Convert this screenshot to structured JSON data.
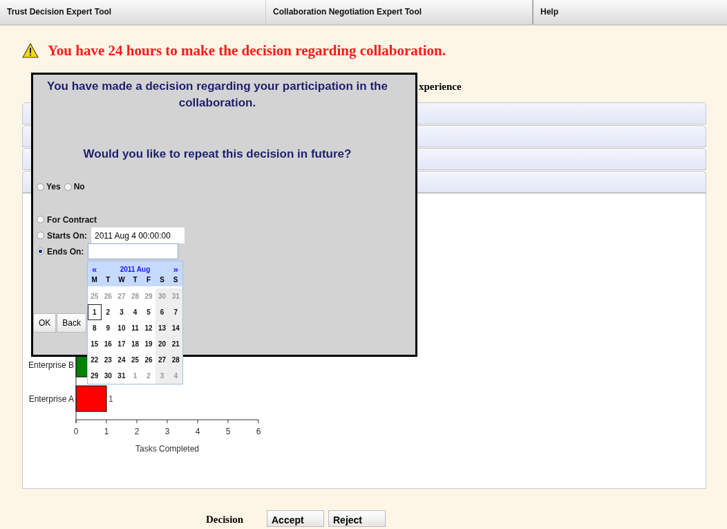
{
  "menu": [
    {
      "label": "Trust Decision Expert Tool"
    },
    {
      "label": "Collaboration Negotiation Expert Tool"
    },
    {
      "label": "Help"
    }
  ],
  "warning": "You have 24 hours to make the decision regarding collaboration.",
  "heading": "xperience",
  "sections": [
    {
      "expanded": false
    },
    {
      "expanded": false
    },
    {
      "expanded": false
    },
    {
      "expanded": true
    }
  ],
  "panel": {
    "covered_bar": {
      "color": "#008000"
    },
    "chart_data": {
      "type": "bar",
      "orientation": "horizontal",
      "categories": [
        "Enterprise B",
        "Enterprise A"
      ],
      "xlabel": "Tasks Completed",
      "xlim": [
        0,
        6
      ],
      "xticks": [
        0,
        1,
        2,
        3,
        4,
        5,
        6
      ],
      "data_labels": true,
      "series": [
        {
          "color": "#ff0000",
          "values": [
            null,
            1
          ]
        }
      ]
    }
  },
  "decision": {
    "label": "Decision",
    "buttons": [
      "Accept",
      "Reject"
    ]
  },
  "dialog": {
    "message": "You have made a decision regarding your participation in the collaboration.",
    "question": "Would you like to repeat this decision in future?",
    "choice": [
      {
        "label": "Yes",
        "selected": false
      },
      {
        "label": "No",
        "selected": false
      }
    ],
    "period": [
      {
        "kind": "plain",
        "label": "For Contract",
        "selected": false
      },
      {
        "kind": "date",
        "label": "Starts On:",
        "value": "2011 Aug 4 00:00:00",
        "selected": false
      },
      {
        "kind": "date",
        "label": "Ends On:",
        "selected": true
      }
    ],
    "buttons": [
      "OK",
      "Back"
    ],
    "calendar": {
      "prev": "«",
      "title": "2011 Aug",
      "next": "»",
      "weekdays": [
        "M",
        "T",
        "W",
        "T",
        "F",
        "S",
        "S"
      ],
      "weeks": [
        [
          {
            "day": "25",
            "outside": true,
            "today": false
          },
          {
            "day": "26",
            "outside": true,
            "today": false
          },
          {
            "day": "27",
            "outside": true,
            "today": false
          },
          {
            "day": "28",
            "outside": true,
            "today": false
          },
          {
            "day": "29",
            "outside": true,
            "today": false
          },
          {
            "day": "30",
            "outside": true,
            "today": false
          },
          {
            "day": "31",
            "outside": true,
            "today": false
          }
        ],
        [
          {
            "day": "1",
            "outside": false,
            "today": true
          },
          {
            "day": "2",
            "outside": false,
            "today": false
          },
          {
            "day": "3",
            "outside": false,
            "today": false
          },
          {
            "day": "4",
            "outside": false,
            "today": false
          },
          {
            "day": "5",
            "outside": false,
            "today": false
          },
          {
            "day": "6",
            "outside": false,
            "today": false
          },
          {
            "day": "7",
            "outside": false,
            "today": false
          }
        ],
        [
          {
            "day": "8",
            "outside": false,
            "today": false
          },
          {
            "day": "9",
            "outside": false,
            "today": false
          },
          {
            "day": "10",
            "outside": false,
            "today": false
          },
          {
            "day": "11",
            "outside": false,
            "today": false
          },
          {
            "day": "12",
            "outside": false,
            "today": false
          },
          {
            "day": "13",
            "outside": false,
            "today": false
          },
          {
            "day": "14",
            "outside": false,
            "today": false
          }
        ],
        [
          {
            "day": "15",
            "outside": false,
            "today": false
          },
          {
            "day": "16",
            "outside": false,
            "today": false
          },
          {
            "day": "17",
            "outside": false,
            "today": false
          },
          {
            "day": "18",
            "outside": false,
            "today": false
          },
          {
            "day": "19",
            "outside": false,
            "today": false
          },
          {
            "day": "20",
            "outside": false,
            "today": false
          },
          {
            "day": "21",
            "outside": false,
            "today": false
          }
        ],
        [
          {
            "day": "22",
            "outside": false,
            "today": false
          },
          {
            "day": "23",
            "outside": false,
            "today": false
          },
          {
            "day": "24",
            "outside": false,
            "today": false
          },
          {
            "day": "25",
            "outside": false,
            "today": false
          },
          {
            "day": "26",
            "outside": false,
            "today": false
          },
          {
            "day": "27",
            "outside": false,
            "today": false
          },
          {
            "day": "28",
            "outside": false,
            "today": false
          }
        ],
        [
          {
            "day": "29",
            "outside": false,
            "today": false
          },
          {
            "day": "30",
            "outside": false,
            "today": false
          },
          {
            "day": "31",
            "outside": false,
            "today": false
          },
          {
            "day": "1",
            "outside": true,
            "today": false
          },
          {
            "day": "2",
            "outside": true,
            "today": false
          },
          {
            "day": "3",
            "outside": true,
            "today": false
          },
          {
            "day": "4",
            "outside": true,
            "today": false
          }
        ]
      ]
    }
  }
}
